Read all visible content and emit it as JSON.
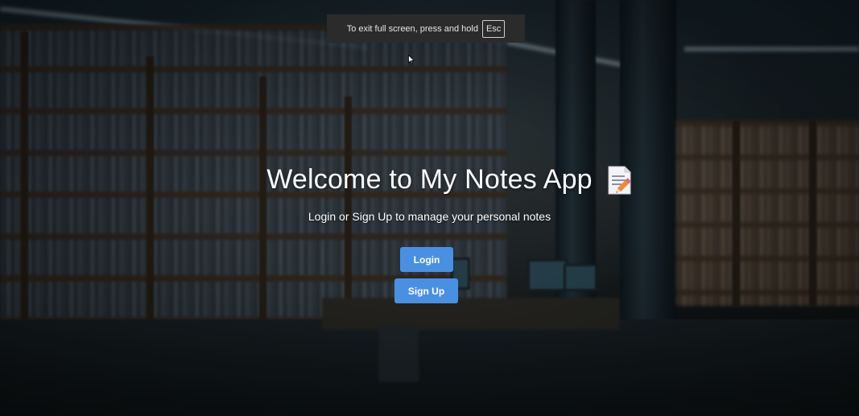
{
  "fullscreen_notice": {
    "text": "To exit full screen, press and hold",
    "key": "Esc"
  },
  "hero": {
    "title": "Welcome to My Notes App",
    "icon": "memo-icon",
    "subtitle": "Login or Sign Up to manage your personal notes"
  },
  "actions": {
    "login_label": "Login",
    "signup_label": "Sign Up"
  },
  "colors": {
    "primary_button": "#4a90e2",
    "notice_background": "#2b2b2b"
  }
}
